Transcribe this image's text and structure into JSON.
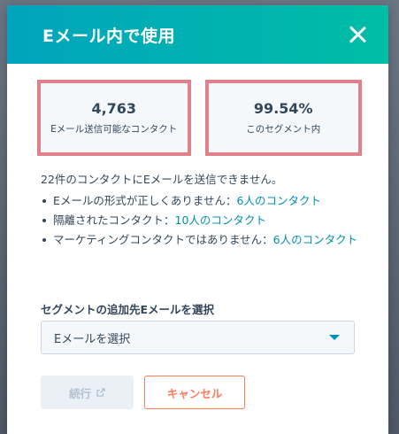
{
  "modal": {
    "title": "Eメール内で使用"
  },
  "stats": [
    {
      "value": "4,763",
      "label": "Eメール送信可能なコンタクト"
    },
    {
      "value": "99.54%",
      "label": "このセグメント内"
    }
  ],
  "info": {
    "summary": "22件のコンタクトにEメールを送信できません。",
    "items": [
      {
        "text": "Eメールの形式が正しくありません：",
        "link": "6人のコンタクト"
      },
      {
        "text": "隔離されたコンタクト：",
        "link": "10人のコンタクト"
      },
      {
        "text": "マーケティングコンタクトではありません：",
        "link": "6人のコンタクト"
      }
    ]
  },
  "email_select": {
    "label": "セグメントの追加先Eメールを選択",
    "value": "Eメールを選択"
  },
  "buttons": {
    "continue_label": "続行",
    "cancel_label": "キャンセル"
  },
  "colors": {
    "header_gradient_start": "#00a4bd",
    "header_gradient_end": "#00bda5",
    "highlight_border": "#e0808a",
    "link": "#0091ae",
    "cancel": "#ff7a59"
  }
}
